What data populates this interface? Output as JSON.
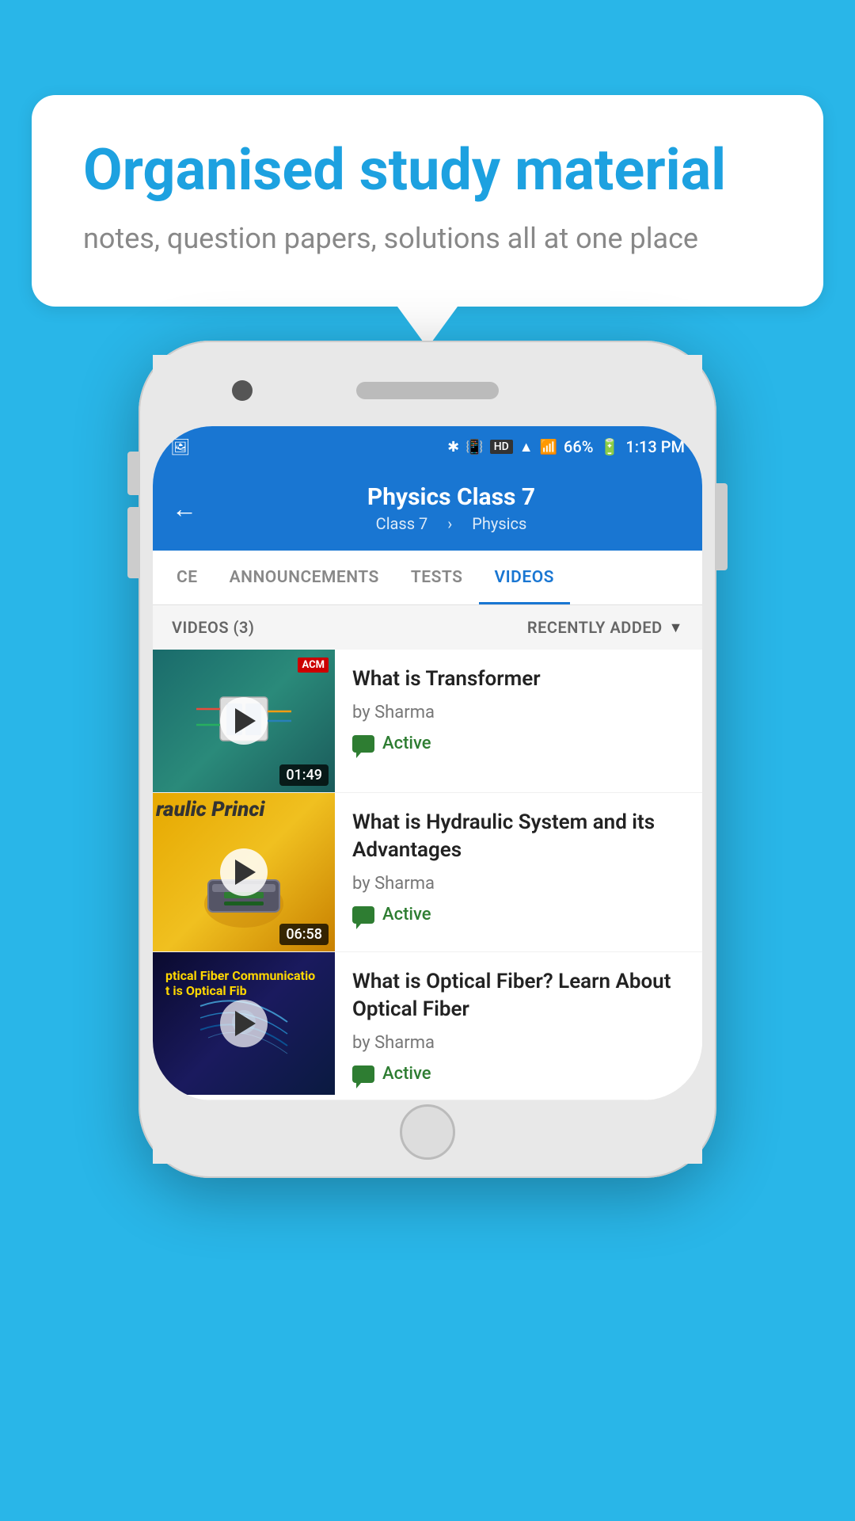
{
  "background_color": "#29b6e8",
  "speech_bubble": {
    "title": "Organised study material",
    "subtitle": "notes, question papers, solutions all at one place"
  },
  "phone": {
    "status_bar": {
      "time": "1:13 PM",
      "battery": "66%",
      "signal_icons": [
        "BT",
        "HD",
        "WiFi",
        "Signal"
      ]
    },
    "header": {
      "title": "Physics Class 7",
      "subtitle_left": "Class 7",
      "subtitle_right": "Physics",
      "back_label": "←"
    },
    "tabs": [
      {
        "label": "CE",
        "active": false
      },
      {
        "label": "ANNOUNCEMENTS",
        "active": false
      },
      {
        "label": "TESTS",
        "active": false
      },
      {
        "label": "VIDEOS",
        "active": true
      }
    ],
    "section_header": {
      "left": "VIDEOS (3)",
      "right": "RECENTLY ADDED"
    },
    "videos": [
      {
        "title": "What is  Transformer",
        "author": "by Sharma",
        "status": "Active",
        "duration": "01:49",
        "thumb_type": "transformer"
      },
      {
        "title": "What is Hydraulic System and its Advantages",
        "author": "by Sharma",
        "status": "Active",
        "duration": "06:58",
        "thumb_type": "hydraulic"
      },
      {
        "title": "What is Optical Fiber? Learn About Optical Fiber",
        "author": "by Sharma",
        "status": "Active",
        "duration": "",
        "thumb_type": "optical"
      }
    ]
  }
}
